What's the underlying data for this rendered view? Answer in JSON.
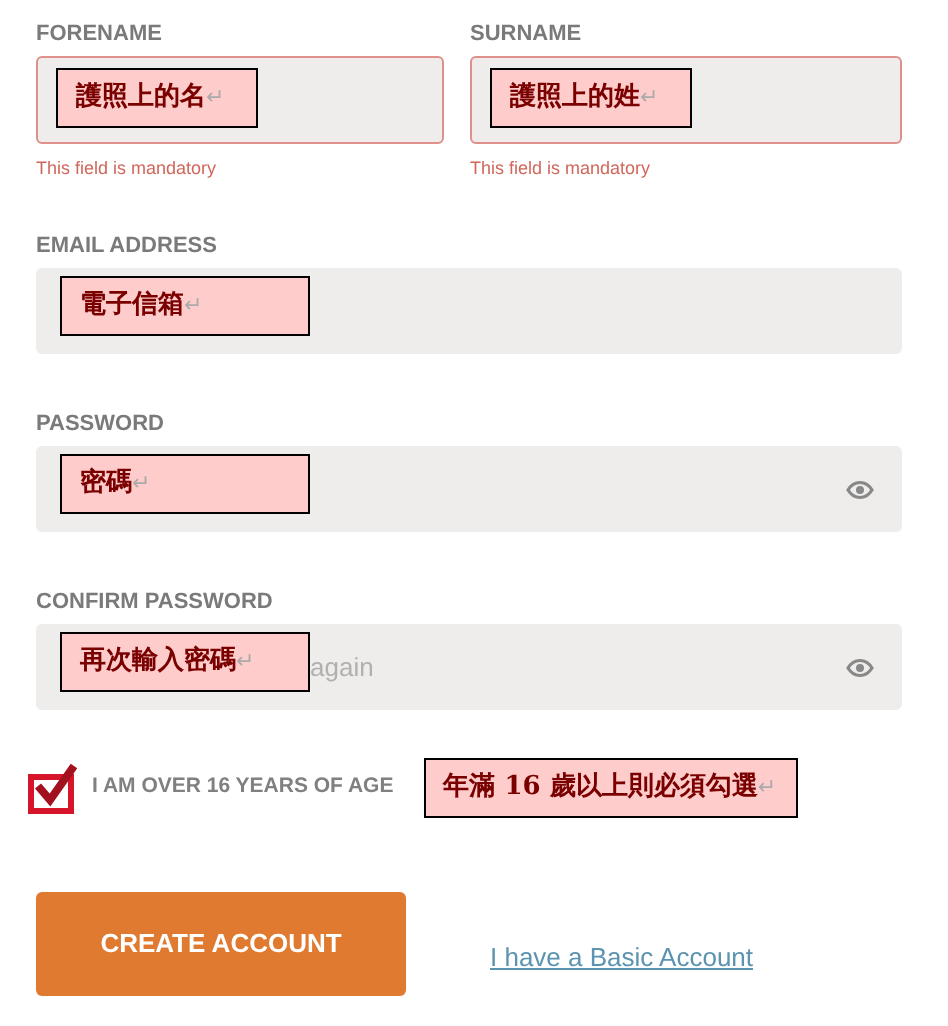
{
  "name_fields": [
    {
      "label": "FORENAME",
      "invalid": true,
      "error": "This field is mandatory",
      "note": {
        "text": "護照上的名",
        "mark": "↵"
      }
    },
    {
      "label": "SURNAME",
      "invalid": true,
      "error": "This field is mandatory",
      "note": {
        "text": "護照上的姓",
        "mark": "↵"
      }
    }
  ],
  "fields": [
    {
      "label": "EMAIL ADDRESS",
      "kind": "text",
      "note": {
        "text": "電子信箱",
        "mark": "↵"
      }
    },
    {
      "label": "PASSWORD",
      "kind": "password",
      "note": {
        "text": "密碼",
        "mark": "↵"
      }
    },
    {
      "label": "CONFIRM PASSWORD",
      "kind": "password",
      "placeholder": "again",
      "note": {
        "text": "再次輸入密碼",
        "mark": "↵"
      }
    }
  ],
  "age_check": {
    "label": "I AM OVER 16 YEARS OF AGE",
    "checked": true,
    "note": {
      "text": "年滿 16 歲以上則必須勾選",
      "mark": "↵"
    }
  },
  "create_button": "CREATE ACCOUNT",
  "basic_link": "I have a Basic Account"
}
